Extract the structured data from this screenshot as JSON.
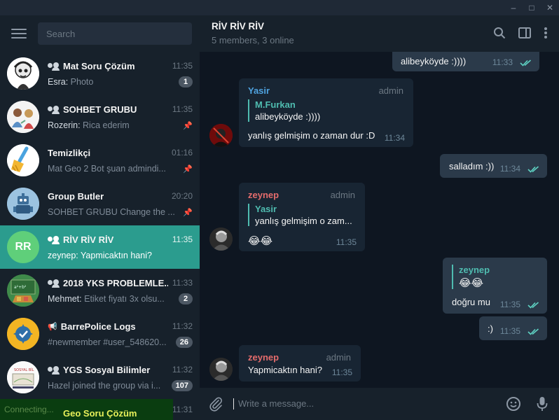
{
  "window": {
    "minimize": "–",
    "maximize": "□",
    "close": "✕"
  },
  "sidebar": {
    "search_placeholder": "Search",
    "chats": [
      {
        "name": "Mat Soru Çözüm",
        "time": "11:35",
        "sender": "Esra:",
        "text": " Photo",
        "badge": "1",
        "type": "group"
      },
      {
        "name": "SOHBET GRUBU",
        "time": "11:35",
        "sender": "Rozerin:",
        "text": " Rica ederim",
        "type": "group",
        "pinned": true
      },
      {
        "name": "Temizlikçi",
        "time": "01:16",
        "sender": "",
        "text": "Mat Geo 2  Bot şuan admindi...",
        "type": "bot",
        "pinned": true
      },
      {
        "name": "Group Butler",
        "time": "20:20",
        "sender": "",
        "text": "SOHBET GRUBU Change the ...",
        "type": "bot",
        "pinned": true
      },
      {
        "name": "RİV RİV RİV",
        "time": "11:35",
        "sender": "",
        "text": "zeynep: Yapmicaktın hani?",
        "type": "group",
        "active": true,
        "initials": "RR"
      },
      {
        "name": "2018 YKS PROBLEMLE...",
        "time": "11:33",
        "sender": "Mehmet:",
        "text": " Etiket fiyatı 3x olsu...",
        "badge": "2",
        "type": "group"
      },
      {
        "name": "BarrePolice Logs",
        "time": "11:32",
        "sender": "",
        "text": "#newmember #user_548620...",
        "badge": "26",
        "type": "channel"
      },
      {
        "name": "YGS Sosyal Bilimler",
        "time": "11:32",
        "sender": "",
        "text": "Hazel joined the group via i...",
        "badge": "107",
        "type": "group"
      },
      {
        "name": "Geo Soru Çözüm",
        "time": "11:31",
        "type": "group"
      }
    ],
    "connecting": "Connecting..."
  },
  "chat": {
    "title": "RİV RİV RİV",
    "subtitle": "5 members, 3 online",
    "composer_placeholder": "Write a message...",
    "messages": {
      "m1": {
        "text": "alibeyköyde :))))",
        "time": "11:33"
      },
      "m2": {
        "sender": "Yasir",
        "role": "admin",
        "reply_name": "M.Furkan",
        "reply_text": "alibeyköyde :))))",
        "text": "yanlış gelmişim o zaman dur :D",
        "time": "11:34"
      },
      "m3": {
        "text": "salladım :))",
        "time": "11:34"
      },
      "m4": {
        "sender": "zeynep",
        "role": "admin",
        "reply_name": "Yasir",
        "reply_text": "yanlış gelmişim o zam...",
        "text": "😂😂",
        "time": "11:35"
      },
      "m5": {
        "reply_name": "zeynep",
        "reply_text": "😂😂",
        "text": "doğru mu",
        "time": "11:35"
      },
      "m6": {
        "text": ":)",
        "time": "11:35"
      },
      "m7": {
        "sender": "zeynep",
        "role": "admin",
        "text": "Yapmicaktın hani?",
        "time": "11:35"
      }
    }
  },
  "colors": {
    "active_chat": "#2b9c8e",
    "yasir": "#4fa3e0",
    "zeynep": "#e56c6c",
    "reply_accent": "#4fbcb0"
  }
}
